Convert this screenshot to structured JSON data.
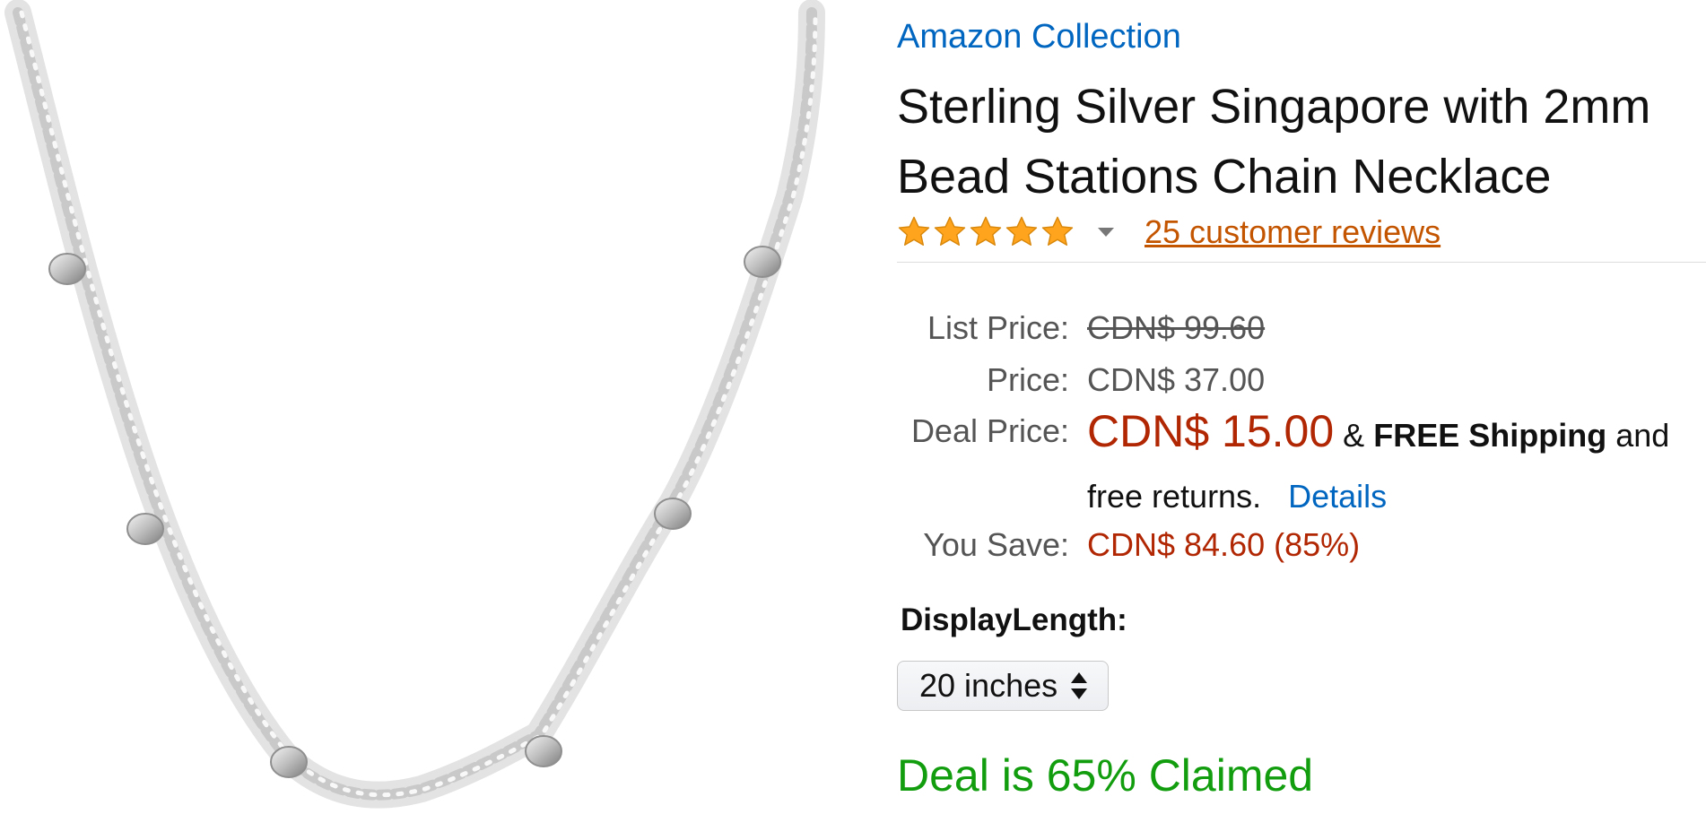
{
  "product": {
    "brand": "Amazon Collection",
    "title_line1": "Sterling Silver Singapore with 2mm",
    "title_line2": "Bead Stations Chain Necklace",
    "image_icon": "necklace-image"
  },
  "rating": {
    "stars": 5,
    "max_stars": 5,
    "reviews_link": "25 customer reviews",
    "star_color": "#ffa41c"
  },
  "pricing": {
    "list_price_label": "List Price:",
    "list_price_value": "CDN$ 99.60",
    "price_label": "Price:",
    "price_value": "CDN$ 37.00",
    "deal_price_label": "Deal Price:",
    "deal_price_value": "CDN$ 15.00",
    "shipping_prefix": "&",
    "shipping_bold": "FREE Shipping",
    "shipping_suffix": "and",
    "returns_text": "free returns.",
    "details_link": "Details",
    "you_save_label": "You Save:",
    "you_save_value": "CDN$ 84.60 (85%)"
  },
  "variation": {
    "label": "DisplayLength:",
    "selected": "20 inches"
  },
  "deal_status": {
    "text": "Deal is 65% Claimed",
    "claimed_percent": 65
  },
  "colors": {
    "link_blue": "#0066c0",
    "price_red": "#b12704",
    "review_orange": "#c45500",
    "deal_green": "#119d0e"
  }
}
